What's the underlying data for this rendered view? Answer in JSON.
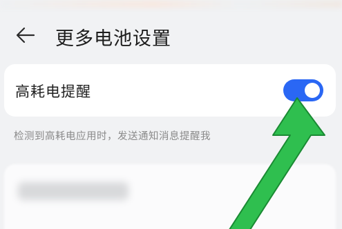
{
  "header": {
    "title": "更多电池设置",
    "back_icon": "back-arrow-icon"
  },
  "settings": {
    "high_drain_reminder": {
      "label": "高耗电提醒",
      "enabled": true,
      "description": "检测到高耗电应用时，发送通知消息提醒我"
    }
  },
  "colors": {
    "toggle_on": "#2a67f4",
    "annotation_arrow": "#2fbf4f",
    "annotation_arrow_border": "#1a8a33"
  }
}
